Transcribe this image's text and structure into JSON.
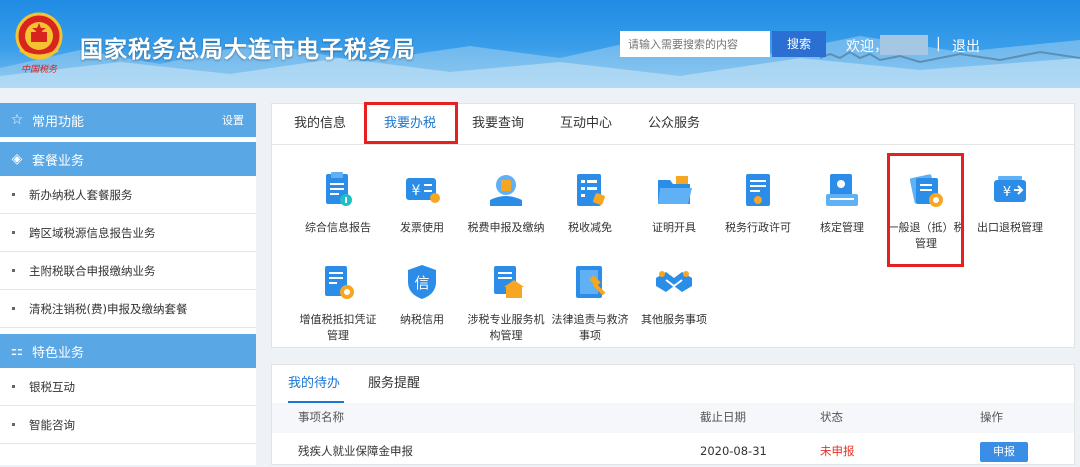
{
  "header": {
    "title": "国家税务总局大连市电子税务局",
    "emblem_caption": "中国税务",
    "search_placeholder": "请输入需要搜索的内容",
    "search_button": "搜索",
    "welcome": "欢迎，",
    "separator": "|",
    "logout": "退出"
  },
  "sidebar": {
    "common": {
      "label": "常用功能",
      "settings": "设置",
      "icon": "star-icon"
    },
    "package": {
      "label": "套餐业务",
      "icon": "layers-icon",
      "items": [
        "新办纳税人套餐服务",
        "跨区域税源信息报告业务",
        "主附税联合申报缴纳业务",
        "清税注销税(费)申报及缴纳套餐"
      ]
    },
    "special": {
      "label": "特色业务",
      "icon": "grid-icon",
      "items": [
        "银税互动",
        "智能咨询"
      ]
    }
  },
  "tabs": [
    "我的信息",
    "我要办税",
    "我要查询",
    "互动中心",
    "公众服务"
  ],
  "services": [
    {
      "label": "综合信息报告",
      "icon": "report-icon"
    },
    {
      "label": "发票使用",
      "icon": "invoice-icon"
    },
    {
      "label": "税费申报及缴纳",
      "icon": "declare-icon"
    },
    {
      "label": "税收减免",
      "icon": "reduction-icon"
    },
    {
      "label": "证明开具",
      "icon": "folder-icon"
    },
    {
      "label": "税务行政许可",
      "icon": "license-icon"
    },
    {
      "label": "核定管理",
      "icon": "check-icon"
    },
    {
      "label": "一般退（抵）税管理",
      "icon": "refund-icon"
    },
    {
      "label": "出口退税管理",
      "icon": "export-refund-icon"
    },
    {
      "label": "增值税抵扣凭证管理",
      "icon": "vat-icon"
    },
    {
      "label": "纳税信用",
      "icon": "credit-icon",
      "glyph": "信"
    },
    {
      "label": "涉税专业服务机构管理",
      "icon": "agency-icon"
    },
    {
      "label": "法律追责与救济事项",
      "icon": "law-icon"
    },
    {
      "label": "其他服务事项",
      "icon": "handshake-icon"
    }
  ],
  "currency_glyph": "¥",
  "todo": {
    "tabs": [
      "我的待办",
      "服务提醒"
    ],
    "columns": [
      "事项名称",
      "截止日期",
      "状态",
      "操作"
    ],
    "rows": [
      {
        "name": "残疾人就业保障金申报",
        "deadline": "2020-08-31",
        "status": "未申报",
        "action": "申报"
      }
    ]
  },
  "colors": {
    "accent": "#1a76d2",
    "highlight": "#e52020",
    "status_pending": "#e8322a"
  }
}
